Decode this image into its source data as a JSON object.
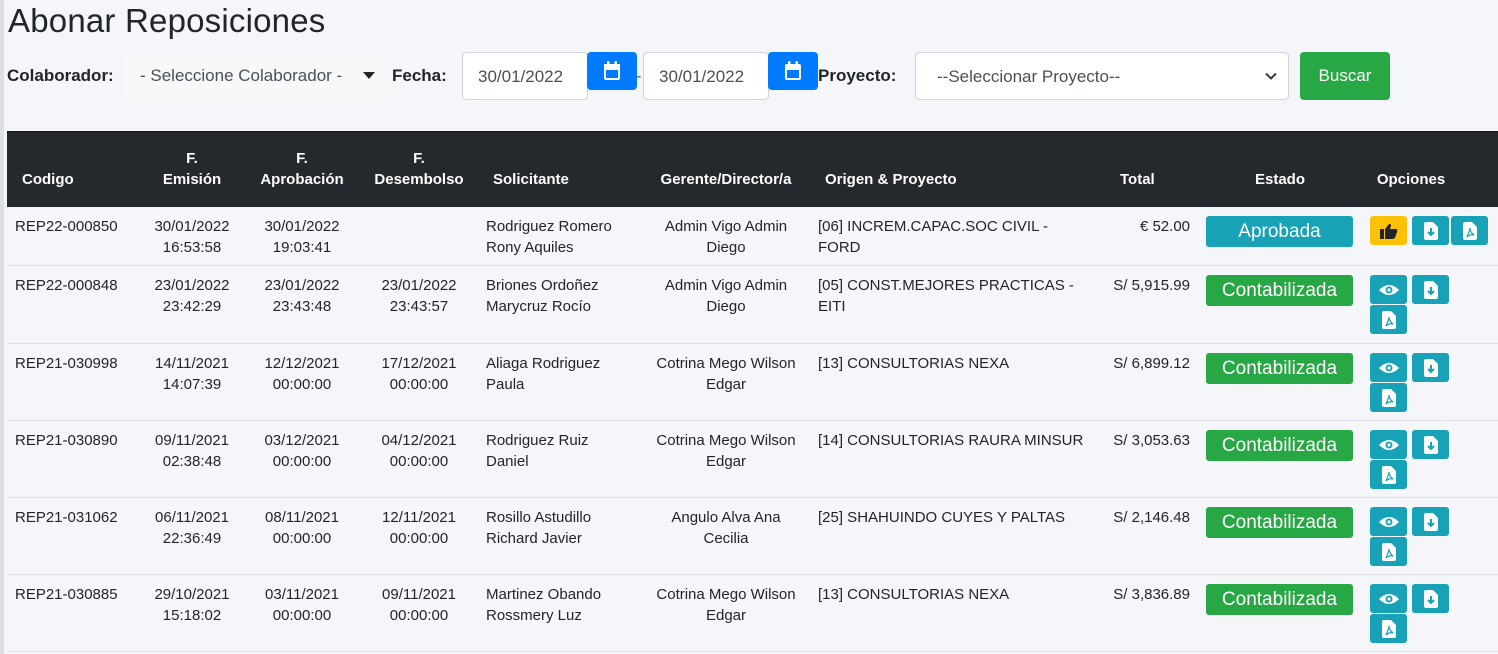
{
  "page": {
    "title": "Abonar Reposiciones"
  },
  "filters": {
    "colaborador_label": "Colaborador:",
    "colaborador_value": "- Seleccione Colaborador -",
    "fecha_label": "Fecha:",
    "date_from": "30/01/2022",
    "date_separator": "-",
    "date_to": "30/01/2022",
    "proyecto_label": "Proyecto:",
    "proyecto_value": "--Seleccionar Proyecto--",
    "search_label": "Buscar"
  },
  "table": {
    "headers": {
      "codigo": "Codigo",
      "f_emision_1": "F.",
      "f_emision_2": "Emisión",
      "f_aprobacion_1": "F.",
      "f_aprobacion_2": "Aprobación",
      "f_desembolso_1": "F.",
      "f_desembolso_2": "Desembolso",
      "solicitante": "Solicitante",
      "gerente": "Gerente/Director/a",
      "origen": "Origen & Proyecto",
      "total": "Total",
      "estado": "Estado",
      "opciones": "Opciones"
    },
    "rows": [
      {
        "codigo": "REP22-000850",
        "emision_fecha": "30/01/2022",
        "emision_hora": "16:53:58",
        "aprobacion_fecha": "30/01/2022",
        "aprobacion_hora": "19:03:41",
        "desembolso_fecha": "",
        "desembolso_hora": "",
        "solicitante_1": "Rodriguez Romero",
        "solicitante_2": "Rony Aquiles",
        "gerente_1": "Admin Vigo Admin",
        "gerente_2": "Diego",
        "origen_1": "[06] INCREM.CAPAC.SOC CIVIL -",
        "origen_2": "FORD",
        "total": "€ 52.00",
        "estado": "Aprobada"
      },
      {
        "codigo": "REP22-000848",
        "emision_fecha": "23/01/2022",
        "emision_hora": "23:42:29",
        "aprobacion_fecha": "23/01/2022",
        "aprobacion_hora": "23:43:48",
        "desembolso_fecha": "23/01/2022",
        "desembolso_hora": "23:43:57",
        "solicitante_1": "Briones Ordoñez",
        "solicitante_2": "Marycruz Rocío",
        "gerente_1": "Admin Vigo Admin",
        "gerente_2": "Diego",
        "origen_1": "[05] CONST.MEJORES PRACTICAS -",
        "origen_2": "EITI",
        "total": "S/ 5,915.99",
        "estado": "Contabilizada"
      },
      {
        "codigo": "REP21-030998",
        "emision_fecha": "14/11/2021",
        "emision_hora": "14:07:39",
        "aprobacion_fecha": "12/12/2021",
        "aprobacion_hora": "00:00:00",
        "desembolso_fecha": "17/12/2021",
        "desembolso_hora": "00:00:00",
        "solicitante_1": "Aliaga Rodriguez",
        "solicitante_2": "Paula",
        "gerente_1": "Cotrina Mego Wilson",
        "gerente_2": "Edgar",
        "origen_1": "[13] CONSULTORIAS NEXA",
        "origen_2": "",
        "total": "S/ 6,899.12",
        "estado": "Contabilizada"
      },
      {
        "codigo": "REP21-030890",
        "emision_fecha": "09/11/2021",
        "emision_hora": "02:38:48",
        "aprobacion_fecha": "03/12/2021",
        "aprobacion_hora": "00:00:00",
        "desembolso_fecha": "04/12/2021",
        "desembolso_hora": "00:00:00",
        "solicitante_1": "Rodriguez Ruiz",
        "solicitante_2": "Daniel",
        "gerente_1": "Cotrina Mego Wilson",
        "gerente_2": "Edgar",
        "origen_1": "[14] CONSULTORIAS RAURA MINSUR",
        "origen_2": "",
        "total": "S/ 3,053.63",
        "estado": "Contabilizada"
      },
      {
        "codigo": "REP21-031062",
        "emision_fecha": "06/11/2021",
        "emision_hora": "22:36:49",
        "aprobacion_fecha": "08/11/2021",
        "aprobacion_hora": "00:00:00",
        "desembolso_fecha": "12/11/2021",
        "desembolso_hora": "00:00:00",
        "solicitante_1": "Rosillo Astudillo",
        "solicitante_2": "Richard Javier",
        "gerente_1": "Angulo Alva Ana",
        "gerente_2": "Cecilia",
        "origen_1": "[25] SHAHUINDO CUYES Y PALTAS",
        "origen_2": "",
        "total": "S/ 2,146.48",
        "estado": "Contabilizada"
      },
      {
        "codigo": "REP21-030885",
        "emision_fecha": "29/10/2021",
        "emision_hora": "15:18:02",
        "aprobacion_fecha": "03/11/2021",
        "aprobacion_hora": "00:00:00",
        "desembolso_fecha": "09/11/2021",
        "desembolso_hora": "00:00:00",
        "solicitante_1": "Martinez Obando",
        "solicitante_2": "Rossmery Luz",
        "gerente_1": "Cotrina Mego Wilson",
        "gerente_2": "Edgar",
        "origen_1": "[13] CONSULTORIAS NEXA",
        "origen_2": "",
        "total": "S/ 3,836.89",
        "estado": "Contabilizada"
      }
    ]
  },
  "icons": {
    "calendar": "calendar-icon",
    "approve": "thumbs-up-icon",
    "view": "eye-icon",
    "download": "download-icon",
    "pdf": "pdf-icon"
  },
  "colors": {
    "primary": "#007bff",
    "success": "#28a745",
    "info": "#17a2b8",
    "warning": "#ffc107",
    "table_header": "#25282c"
  }
}
